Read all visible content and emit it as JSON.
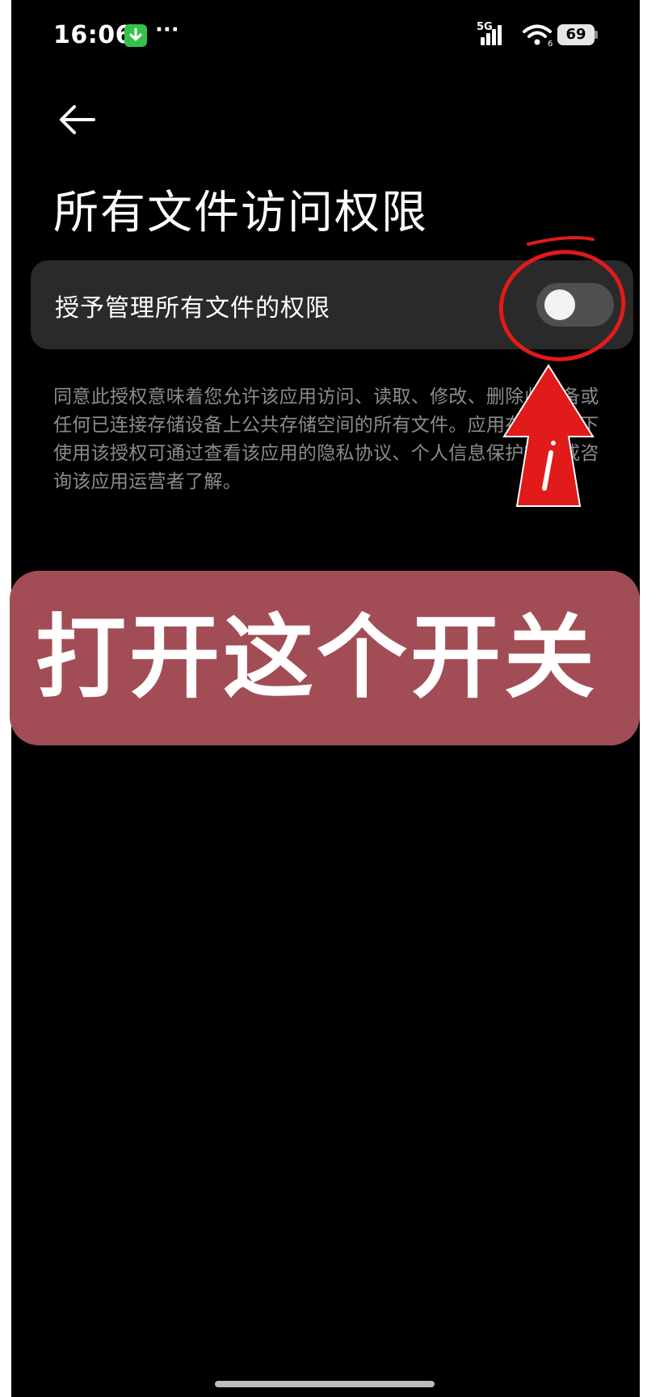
{
  "status_bar": {
    "time": "16:06",
    "notification_icons": [
      "download-icon",
      "more-icon"
    ],
    "more": "···",
    "network": "5G",
    "wifi_badge": "6",
    "battery": "69"
  },
  "header": {
    "back_icon": "arrow-left-icon",
    "title": "所有文件访问权限"
  },
  "setting": {
    "label": "授予管理所有文件的权限",
    "toggle_on": false
  },
  "description": "同意此授权意味着您允许该应用访问、读取、修改、删除此设备或任何已连接存储设备上公共存储空间的所有文件。应用在何情况下使用该授权可通过查看该应用的隐私协议、个人信息保护规则或咨询该应用运营者了解。",
  "annotation": {
    "callout": "打开这个开关",
    "circle_color": "#e11a1a",
    "arrow_color": "#e11a1a",
    "banner_color": "#a24d56"
  }
}
